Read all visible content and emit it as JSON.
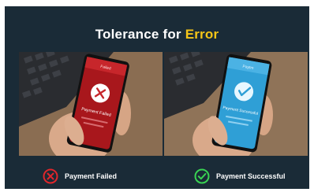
{
  "title": {
    "prefix": "Tolerance for",
    "accent": "Error"
  },
  "colors": {
    "background": "#1a2b37",
    "accent": "#f5c518",
    "failure": "#e0262b",
    "success": "#39d353",
    "failed_screen": "#a8171c",
    "success_screen": "#2f9fd6"
  },
  "panels": {
    "failed": {
      "screen_header": "Failed",
      "screen_message": "Payment Failed",
      "status_icon": "x-circle-icon",
      "status_label": "Payment Failed"
    },
    "success": {
      "screen_header": "Paytm",
      "screen_message": "Payment Successful",
      "status_icon": "check-circle-icon",
      "status_label": "Payment Successful"
    }
  }
}
